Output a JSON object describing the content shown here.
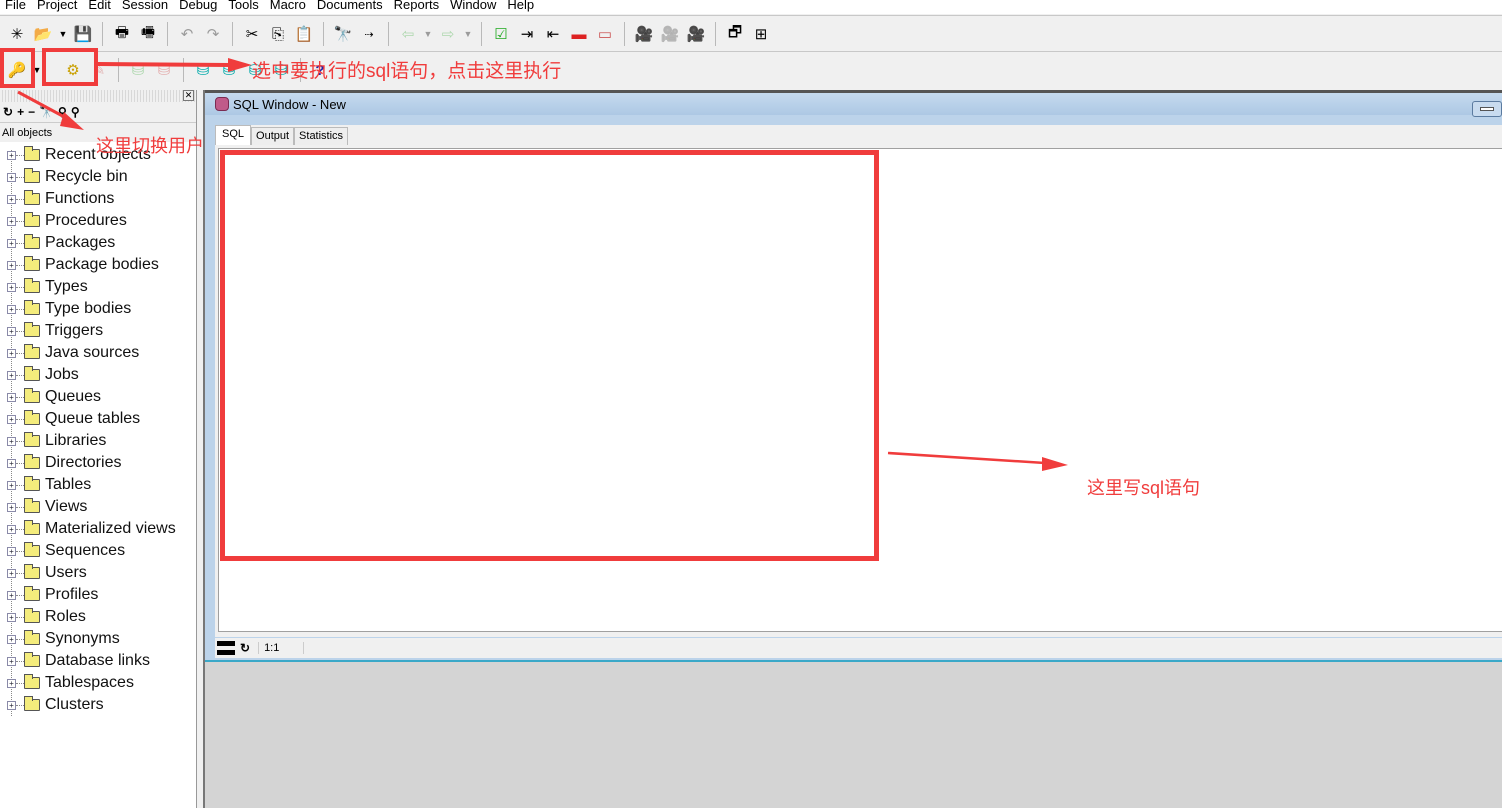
{
  "menu": [
    "File",
    "Project",
    "Edit",
    "Session",
    "Debug",
    "Tools",
    "Macro",
    "Documents",
    "Reports",
    "Window",
    "Help"
  ],
  "toolbar1": {
    "icons": [
      "new-icon",
      "open-icon",
      "dropdown-icon",
      "save-icon",
      "print-icon",
      "print-setup-icon",
      "undo-icon",
      "redo-icon",
      "cut-icon",
      "copy-icon",
      "paste-icon",
      "find-icon",
      "find-next-icon",
      "back-icon",
      "forward-icon",
      "check-icon",
      "indent-icon",
      "unindent-icon",
      "comment-icon",
      "uncomment-icon",
      "record-macro-icon",
      "play-macro-icon",
      "macro-library-icon",
      "windows-icon",
      "tile-icon"
    ]
  },
  "toolbar2": {
    "icons": [
      "log-on-icon",
      "dropdown-icon",
      "execute-icon",
      "break-icon",
      "commit-icon",
      "rollback-icon",
      "db-icon-1",
      "db-icon-2",
      "db-icon-3",
      "db-icon-4",
      "help-icon"
    ]
  },
  "object_browser": {
    "filter": "All objects",
    "items": [
      "Recent objects",
      "Recycle bin",
      "Functions",
      "Procedures",
      "Packages",
      "Package bodies",
      "Types",
      "Type bodies",
      "Triggers",
      "Java sources",
      "Jobs",
      "Queues",
      "Queue tables",
      "Libraries",
      "Directories",
      "Tables",
      "Views",
      "Materialized views",
      "Sequences",
      "Users",
      "Profiles",
      "Roles",
      "Synonyms",
      "Database links",
      "Tablespaces",
      "Clusters"
    ]
  },
  "sql_window": {
    "title": "SQL Window - New",
    "tabs": [
      "SQL",
      "Output",
      "Statistics"
    ],
    "active_tab": "SQL",
    "editor_value": "",
    "cursor_position": "1:1"
  },
  "annotations": {
    "execute_hint": "选中要执行的sql语句，点击这里执行",
    "switch_user_hint": "这里切换用户",
    "write_sql_hint": "这里写sql语句",
    "color": "#f03c3c"
  }
}
